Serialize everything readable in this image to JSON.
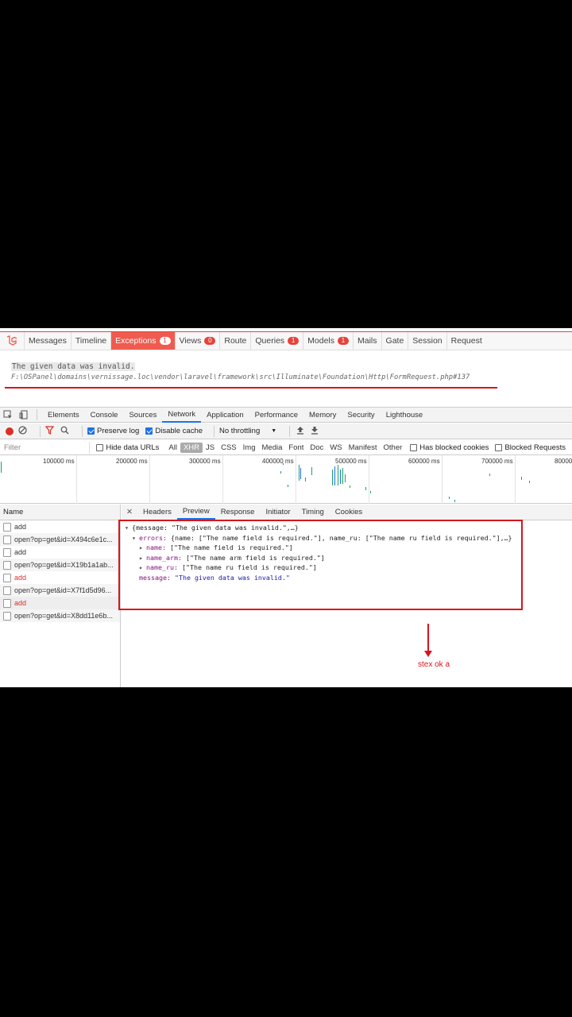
{
  "debugbar": {
    "tabs": [
      {
        "label": "Messages",
        "badge": null
      },
      {
        "label": "Timeline",
        "badge": null
      },
      {
        "label": "Exceptions",
        "badge": "1",
        "active": true
      },
      {
        "label": "Views",
        "badge": "0"
      },
      {
        "label": "Route",
        "badge": null
      },
      {
        "label": "Queries",
        "badge": "1"
      },
      {
        "label": "Models",
        "badge": "1"
      },
      {
        "label": "Mails",
        "badge": null
      },
      {
        "label": "Gate",
        "badge": null
      },
      {
        "label": "Session",
        "badge": null
      },
      {
        "label": "Request",
        "badge": null
      }
    ],
    "exception_message": "The given data was invalid.",
    "exception_path": "F:\\OSPanel\\domains\\vernissage.loc\\vendor\\laravel\\framework\\src\\Illuminate\\Foundation\\Http\\FormRequest.php#137"
  },
  "devtools": {
    "tabs": [
      "Elements",
      "Console",
      "Sources",
      "Network",
      "Application",
      "Performance",
      "Memory",
      "Security",
      "Lighthouse"
    ],
    "active_tab": "Network",
    "toolbar": {
      "preserve_log": "Preserve log",
      "disable_cache": "Disable cache",
      "throttling": "No throttling"
    },
    "filter": {
      "placeholder": "Filter",
      "hide_data_urls": "Hide data URLs",
      "types": [
        "All",
        "XHR",
        "JS",
        "CSS",
        "Img",
        "Media",
        "Font",
        "Doc",
        "WS",
        "Manifest",
        "Other"
      ],
      "active_type": "XHR",
      "has_blocked_cookies": "Has blocked cookies",
      "blocked_requests": "Blocked Requests"
    },
    "timeline_ticks": [
      "100000 ms",
      "200000 ms",
      "300000 ms",
      "400000 ms",
      "500000 ms",
      "600000 ms",
      "700000 ms",
      "80000"
    ],
    "name_header": "Name",
    "requests": [
      {
        "name": "add",
        "error": false
      },
      {
        "name": "open?op=get&id=X494c6e1c...",
        "error": false
      },
      {
        "name": "add",
        "error": false
      },
      {
        "name": "open?op=get&id=X19b1a1ab...",
        "error": false
      },
      {
        "name": "add",
        "error": true
      },
      {
        "name": "open?op=get&id=X7f1d5d96...",
        "error": false
      },
      {
        "name": "add",
        "error": true,
        "selected": true
      },
      {
        "name": "open?op=get&id=X8dd11e6b...",
        "error": false
      }
    ],
    "detail_tabs": [
      "Headers",
      "Preview",
      "Response",
      "Initiator",
      "Timing",
      "Cookies"
    ],
    "active_detail_tab": "Preview",
    "preview": {
      "root": "{message: \"The given data was invalid.\",…}",
      "errors_key": "errors:",
      "errors_summary": "{name: [\"The name field is required.\"], name_ru: [\"The name ru field is required.\"],…}",
      "name_key": "name:",
      "name_val": "[\"The name field is required.\"]",
      "name_arm_key": "name_arm:",
      "name_arm_val": "[\"The name arm field is required.\"]",
      "name_ru_key": "name_ru:",
      "name_ru_val": "[\"The name ru field is required.\"]",
      "message_key": "message:",
      "message_val": "\"The given data was invalid.\""
    }
  },
  "annotation": {
    "note": "stex ok a",
    "color": "#d9141d"
  }
}
